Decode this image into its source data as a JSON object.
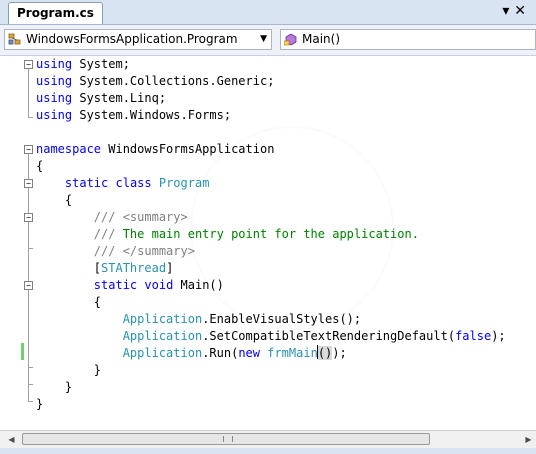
{
  "tab": {
    "label": "Program.cs",
    "close_glyph": "▾ ✕"
  },
  "navbar": {
    "type_combo": {
      "value": "WindowsFormsApplication.Program",
      "icon": "class-icon"
    },
    "member_combo": {
      "value": "Main()",
      "icon": "method-icon"
    }
  },
  "colors": {
    "keyword": "#0000ff",
    "type": "#2b91af",
    "comment": "#008000",
    "doc_tag": "#808080",
    "change_bar": "#6ed16e"
  },
  "code": {
    "lines": [
      "using System;",
      "using System.Collections.Generic;",
      "using System.Linq;",
      "using System.Windows.Forms;",
      "",
      "namespace WindowsFormsApplication",
      "{",
      "    static class Program",
      "    {",
      "        /// <summary>",
      "        /// The main entry point for the application.",
      "        /// </summary>",
      "        [STAThread]",
      "        static void Main()",
      "        {",
      "            Application.EnableVisualStyles();",
      "            Application.SetCompatibleTextRenderingDefault(false);",
      "            Application.Run(new frmMain());",
      "        }",
      "    }",
      "}"
    ]
  }
}
